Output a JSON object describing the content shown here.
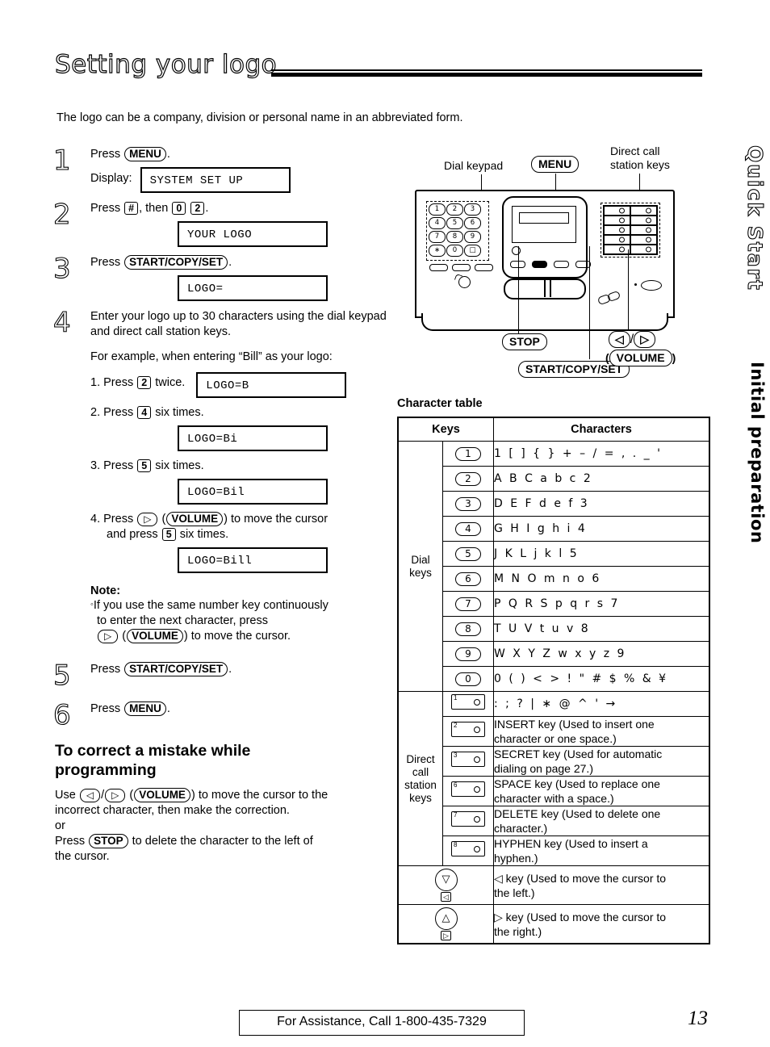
{
  "title": "Setting your logo",
  "intro": "The logo can be a company, division or personal name in an abbreviated form.",
  "steps": {
    "s1": {
      "num": "1",
      "press": "Press",
      "key": "MENU",
      "tail": ".",
      "display_label": "Display:",
      "display_value": "SYSTEM SET UP"
    },
    "s2": {
      "num": "2",
      "press": "Press",
      "key1": "#",
      "mid": ", then",
      "key2": "0",
      "key3": "2",
      "tail": ".",
      "display_value": "YOUR LOGO"
    },
    "s3": {
      "num": "3",
      "press": "Press",
      "key": "START/COPY/SET",
      "tail": ".",
      "display_value": "LOGO="
    },
    "s4": {
      "num": "4",
      "text": "Enter your logo up to 30 characters using the dial keypad and direct call station keys.",
      "example_intro": "For example, when entering “Bill” as your logo:",
      "items": [
        {
          "n": "1.",
          "pre": "Press",
          "key": "2",
          "post": "twice.",
          "display_value": "LOGO=B"
        },
        {
          "n": "2.",
          "pre": "Press",
          "key": "4",
          "post": "six times.",
          "display_value": "LOGO=Bi"
        },
        {
          "n": "3.",
          "pre": "Press",
          "key": "5",
          "post": "six times.",
          "display_value": "LOGO=Bil"
        },
        {
          "n": "4.",
          "pre": "Press",
          "key": "▷",
          "key2": "VOLUME",
          "post": "to move the cursor",
          "post2a": "and press",
          "post2key": "5",
          "post2b": "six times.",
          "display_value": "LOGO=Bill"
        }
      ]
    },
    "s5": {
      "num": "5",
      "press": "Press",
      "key": "START/COPY/SET",
      "tail": "."
    },
    "s6": {
      "num": "6",
      "press": "Press",
      "key": "MENU",
      "tail": "."
    }
  },
  "note": {
    "title": "Note:",
    "line1": "If you use the same number key continuously",
    "line2": "to enter the next character, press",
    "line3_key1": "▷",
    "line3_key2": "VOLUME",
    "line3_tail": "to move the cursor."
  },
  "correct_section": {
    "heading_l1": "To correct a mistake while",
    "heading_l2": "programming",
    "use": "Use",
    "key_left": "◁",
    "key_right": "▷",
    "key_volume": "VOLUME",
    "line1_tail": "to move the cursor to the",
    "line2": "incorrect character, then make the correction.",
    "or": "or",
    "press": "Press",
    "key_stop": "STOP",
    "line3_tail": "to delete the character to the left of",
    "line4": "the cursor."
  },
  "diagram": {
    "label_dialpad": "Dial keypad",
    "label_menu": "MENU",
    "label_direct_l1": "Direct call",
    "label_direct_l2": "station keys",
    "label_stop": "STOP",
    "label_left_arrow": "◁",
    "label_slash": "/",
    "label_right_arrow": "▷",
    "label_volume_open": "(",
    "label_volume": "VOLUME",
    "label_volume_close": ")",
    "label_startcopyset": "START/COPY/SET",
    "keypad_keys": [
      "1",
      "2",
      "3",
      "4",
      "5",
      "6",
      "7",
      "8",
      "9",
      "∗",
      "0",
      "□"
    ]
  },
  "character_table": {
    "caption": "Character table",
    "head_keys": "Keys",
    "head_characters": "Characters",
    "group_dial_l1": "Dial",
    "group_dial_l2": "keys",
    "group_direct_l1": "Direct",
    "group_direct_l2": "call",
    "group_direct_l3": "station",
    "group_direct_l4": "keys",
    "dial_rows": [
      {
        "key": "1",
        "chars": "1 [ ] { } + – / = , . _ '"
      },
      {
        "key": "2",
        "chars": "A B C a b c 2"
      },
      {
        "key": "3",
        "chars": "D E F d e f 3"
      },
      {
        "key": "4",
        "chars": "G H I g h i 4"
      },
      {
        "key": "5",
        "chars": "J K L j k l 5"
      },
      {
        "key": "6",
        "chars": "M N O m n o 6"
      },
      {
        "key": "7",
        "chars": "P Q R S p q r s 7"
      },
      {
        "key": "8",
        "chars": "T U V t u v 8"
      },
      {
        "key": "9",
        "chars": "W X Y Z w x y z 9"
      },
      {
        "key": "0",
        "chars": "0 ( ) < > ! \" # $ % & ¥"
      }
    ],
    "station_rows": [
      {
        "key": "1",
        "chars": ": ; ? | ∗ @ ^ ' →",
        "desc": ""
      },
      {
        "key": "2",
        "desc_l1": "INSERT key (Used to insert one",
        "desc_l2": "character or one space.)"
      },
      {
        "key": "3",
        "desc_l1": "SECRET key (Used for automatic",
        "desc_l2": "dialing on page 27.)"
      },
      {
        "key": "6",
        "desc_l1": "SPACE key (Used to replace one",
        "desc_l2": "character with a space.)"
      },
      {
        "key": "7",
        "desc_l1": "DELETE key (Used to delete one",
        "desc_l2": "character.)"
      },
      {
        "key": "8",
        "desc_l1": "HYPHEN key (Used to insert a",
        "desc_l2": "hyphen.)"
      }
    ],
    "arrow_rows": [
      {
        "glyph": "▽",
        "mini": "◁",
        "desc_l1": "◁ key (Used to move the cursor to",
        "desc_l2": "the left.)"
      },
      {
        "glyph": "△",
        "mini": "▷",
        "desc_l1": "▷ key (Used to move the cursor to",
        "desc_l2": "the right.)"
      }
    ]
  },
  "side_tabs": {
    "quick_start": "Quick Start",
    "initial_preparation": "Initial preparation"
  },
  "footer": {
    "assistance": "For Assistance, Call 1-800-435-7329",
    "page_number": "13"
  }
}
